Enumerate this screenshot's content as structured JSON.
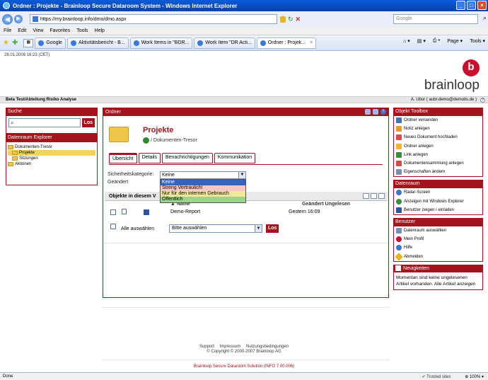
{
  "window": {
    "title": "Ordner : Projekte - Brainloop Secure Dataroom System - Windows Internet Explorer"
  },
  "browser": {
    "url": "https://my.brainloop.info/dmo/dmo.aspx",
    "search_placeholder": "Google",
    "menu": [
      "File",
      "Edit",
      "View",
      "Favorites",
      "Tools",
      "Help"
    ],
    "tabs": [
      {
        "label": "Google",
        "active": false
      },
      {
        "label": "Aktivitätsbericht - B...",
        "active": false
      },
      {
        "label": "Work Items in \"BDR...",
        "active": false
      },
      {
        "label": "Work Item \"DR Acti...",
        "active": false
      },
      {
        "label": "Ordner : Projek...",
        "active": true
      }
    ],
    "commands": {
      "page": "Page",
      "tools": "Tools"
    },
    "status": {
      "left": "Done",
      "zone": "Trusted sites",
      "zoom": "100%"
    }
  },
  "page": {
    "datetime": "28.01.2008 16:23 (CET)",
    "logo": "brainloop",
    "logo_badge": "b",
    "org_path": "Beta Test/Abteilung Risiko Analyse",
    "user": "A. Ubor ( aubr.demo@demoits.de )",
    "search": {
      "header": "Suche",
      "button": "Los"
    },
    "explorer": {
      "header": "Datenraum Explorer",
      "items": [
        {
          "label": "Dokumenten-Tresor",
          "level": 0
        },
        {
          "label": "Projekte",
          "level": 1,
          "selected": true
        },
        {
          "label": "Sitzungen",
          "level": 1
        },
        {
          "label": "Aktionen",
          "level": 0
        }
      ]
    },
    "folder": {
      "header": "Ordner",
      "title": "Projekte",
      "breadcrumb": "/ Dokumenten-Tresor",
      "tabs": [
        "Übersicht",
        "Details",
        "Benachrichtigungen",
        "Kommunikation"
      ],
      "security_label": "Sicherheitskategorie:",
      "security_value": "Keine",
      "security_options": [
        "Keine",
        "Streng Vertraulich!",
        "Nur für den internen Gebrauch",
        "Öffentlich"
      ],
      "changed_label": "Geändert",
      "objects_header": "Objekte in diesem V",
      "col_name": "Name",
      "col_changed": "Geändert Ungelesen",
      "rows": [
        {
          "name": "Demo-Report",
          "changed": "Gestern 16:09"
        }
      ],
      "select_all": "Alle auswählen",
      "bulk_placeholder": "Bitte auswählen",
      "bulk_button": "Los"
    },
    "toolbox": {
      "header": "Objekt Toolbox",
      "items": [
        "Ordner versenden",
        "Notiz anlegen",
        "Neues Dokument hochladen",
        "Ordner anlegen",
        "Link anlegen",
        "Dokumentensammlung anlegen",
        "Eigenschaften ändern"
      ]
    },
    "dataroom": {
      "header": "Datenraum",
      "items": [
        "Radar-Screen",
        "Anzeigen mit Windows Explorer",
        "Benutzer zeigen / einladen"
      ]
    },
    "user_panel": {
      "header": "Benutzer",
      "items": [
        "Datenraum auswählen",
        "Mein Profil",
        "Hilfe",
        "Abmelden"
      ]
    },
    "news": {
      "header": "Neuigkeiten",
      "body": "Momentan sind keine ungelesenen Artikel vorhanden. Alle Artikel anzeigen"
    },
    "footer": {
      "links": [
        "Support",
        "Impressum",
        "Nutzungsbedingungen"
      ],
      "copyright": "© Copyright © 2000-2007 Brainloop AG",
      "solution": "Brainloop Secure Dataroom Solution (INFO 7.00.006)"
    }
  }
}
